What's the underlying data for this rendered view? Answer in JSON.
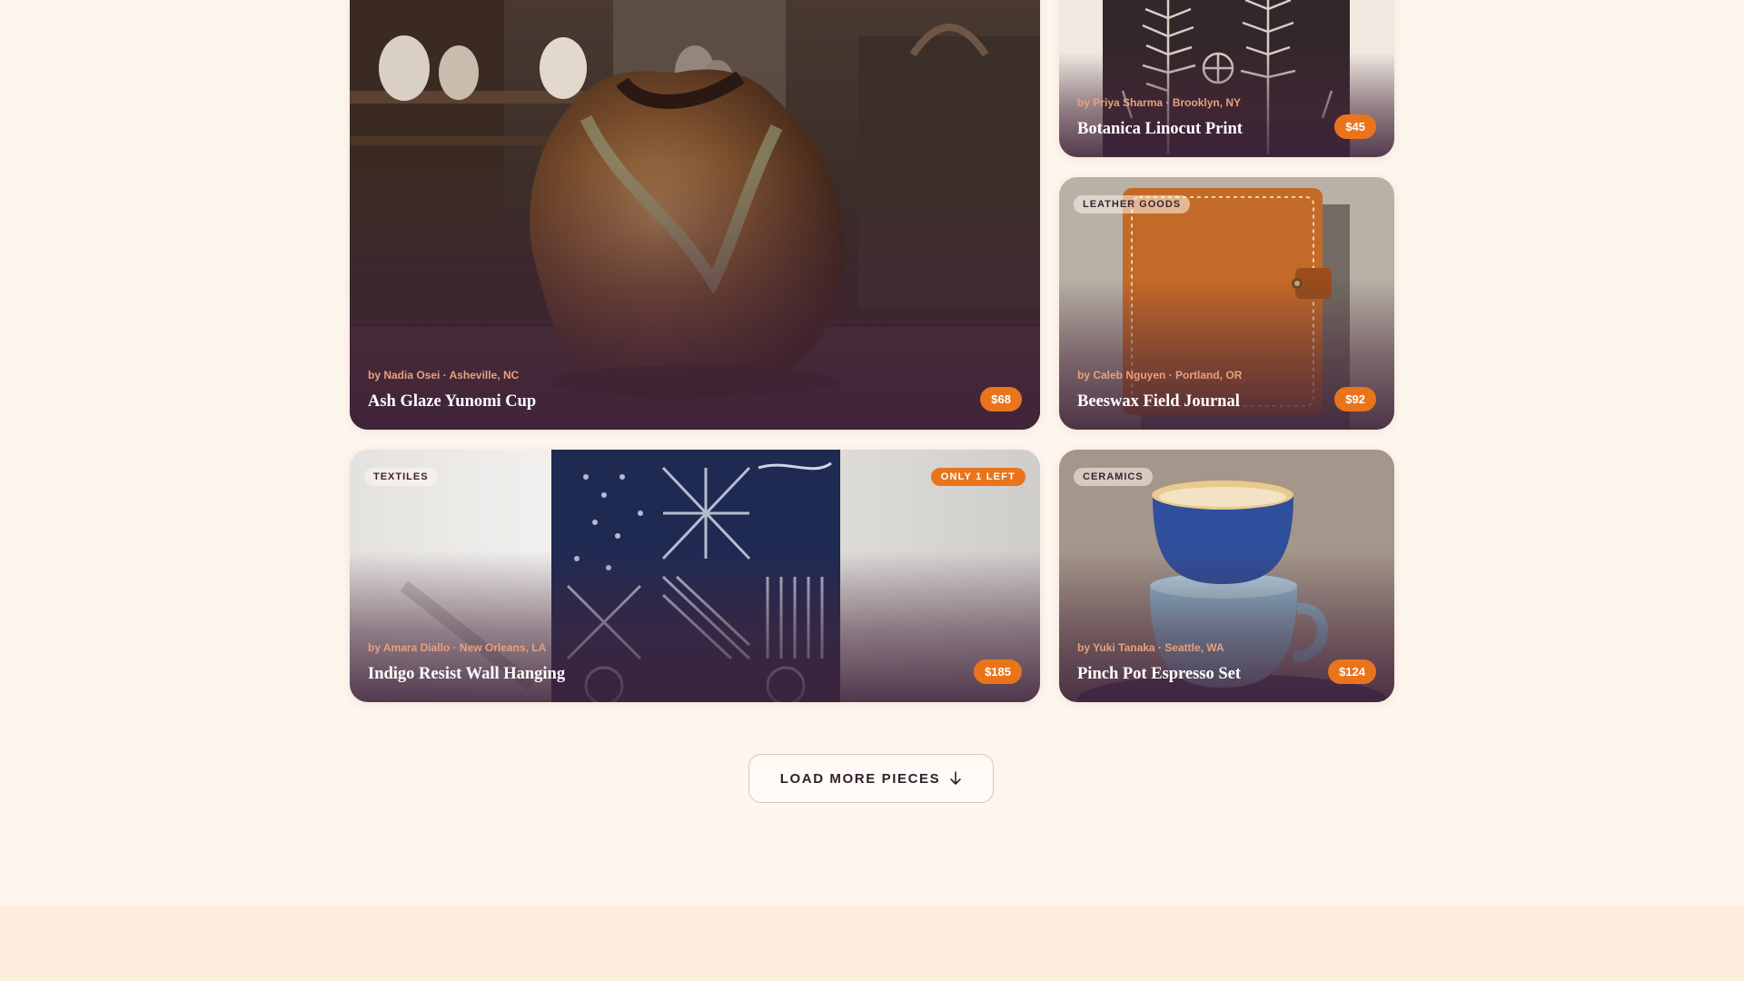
{
  "products": [
    {
      "category": "",
      "maker": "by Nadia Osei · Asheville, NC",
      "title": "Ash Glaze Yunomi Cup",
      "price": "$68",
      "badge": ""
    },
    {
      "category": "",
      "maker": "by Priya Sharma · Brooklyn, NY",
      "title": "Botanica Linocut Print",
      "price": "$45",
      "badge": ""
    },
    {
      "category": "LEATHER GOODS",
      "maker": "by Caleb Nguyen · Portland, OR",
      "title": "Beeswax Field Journal",
      "price": "$92",
      "badge": ""
    },
    {
      "category": "TEXTILES",
      "maker": "by Amara Diallo · New Orleans, LA",
      "title": "Indigo Resist Wall Hanging",
      "price": "$185",
      "badge": "ONLY 1 LEFT"
    },
    {
      "category": "CERAMICS",
      "maker": "by Yuki Tanaka · Seattle, WA",
      "title": "Pinch Pot Espresso Set",
      "price": "$124",
      "badge": ""
    }
  ],
  "load_more": {
    "label": "LOAD MORE PIECES",
    "icon": "arrow-down-icon"
  },
  "colors": {
    "page_background": "#fef5ec",
    "footer_band": "#fdeddc",
    "accent": "#e9741c",
    "maker_text": "#e8a07c"
  }
}
